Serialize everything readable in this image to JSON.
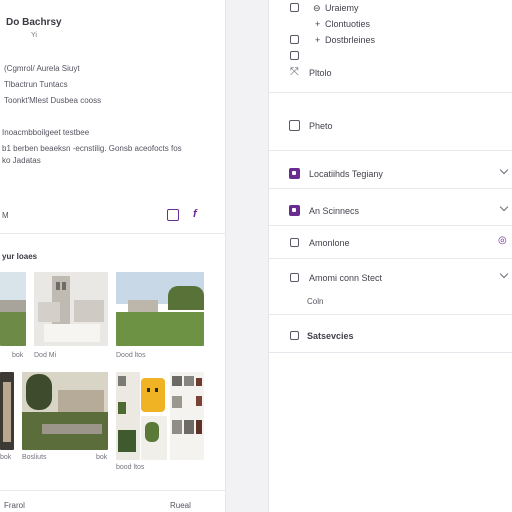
{
  "left": {
    "title": "Do Bachrsy",
    "subtitle": "Yi",
    "info_lines": [
      "(Cgmrol/ Aurela Siuyt",
      "Tlbactrun Tuntacs",
      "Toonkt'Mlest Dusbea cooss"
    ],
    "desc_heading": "Inoacmbboilgeet testbee",
    "desc_lines": [
      "b1 berben beaeksn -ecnstilig. Gonsb aceofocts fos",
      "ko Jadatas"
    ],
    "meta_label": "M",
    "section_label": "yur loaes",
    "thumb_captions_row1": [
      "bok",
      "Dod Mi",
      "Dood ltos"
    ],
    "thumb_captions_row2": [
      "bok",
      "Bosliuts",
      "bok",
      "bood ltos"
    ],
    "footer_left": "Frarol",
    "footer_right": "Rueal",
    "colors": {
      "accent": "#6a2c91"
    },
    "icons": [
      "share-icon",
      "facebook-icon"
    ]
  },
  "right": {
    "top_items": [
      {
        "icon": "grid-icon",
        "label": "Uraiemy",
        "prefix": "⊖"
      },
      {
        "icon": "none",
        "label": "Clontuoties",
        "prefix": "+"
      },
      {
        "icon": "grid-icon",
        "label": "Dostbrleines",
        "prefix": "+"
      },
      {
        "icon": "grid-icon",
        "label": "",
        "prefix": ""
      },
      {
        "icon": "expand-icon",
        "label": "Pltolo",
        "prefix": ""
      }
    ],
    "sections": [
      {
        "label": "Pheto",
        "icon": "square-icon",
        "filled": false,
        "chevron": false
      },
      {
        "label": "Locatiihds Tegiany",
        "icon": "square-icon",
        "filled": true,
        "chevron": true
      },
      {
        "label": "An Scinnecs",
        "icon": "square-icon",
        "filled": true,
        "chevron": true
      },
      {
        "label": "Amonlone",
        "icon": "image-icon",
        "filled": false,
        "chevron": false,
        "trailing": "info-icon"
      },
      {
        "label": "Amomi conn Stect",
        "icon": "image-icon",
        "filled": false,
        "chevron": true
      },
      {
        "label": "Satsevcies",
        "icon": "gear-icon",
        "filled": false,
        "chevron": false
      }
    ],
    "sub_label": "Coln"
  }
}
